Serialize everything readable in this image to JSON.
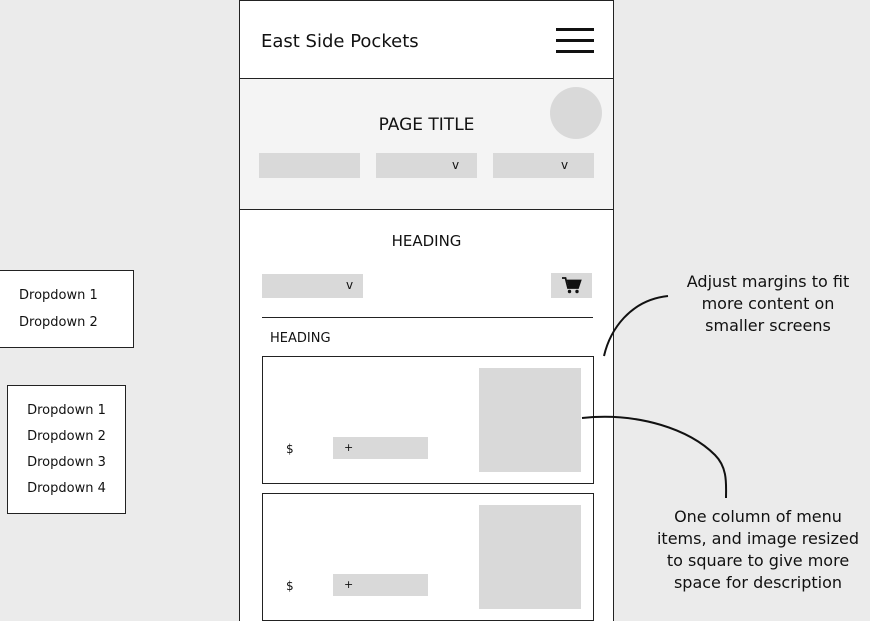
{
  "header": {
    "brand": "East Side Pockets",
    "menu_icon": "hamburger-menu-icon"
  },
  "hero": {
    "title": "PAGE TITLE",
    "filters": [
      {
        "caret": ""
      },
      {
        "caret": "v"
      },
      {
        "caret": "v"
      }
    ]
  },
  "section": {
    "heading": "HEADING",
    "sort_caret": "v",
    "cart_icon": "shopping-cart-icon",
    "subheading": "HEADING"
  },
  "menu_items": [
    {
      "price": "$",
      "add_label": "+"
    },
    {
      "price": "$",
      "add_label": "+"
    }
  ],
  "dropdown_small": {
    "items": [
      "Dropdown 1",
      "Dropdown 2"
    ]
  },
  "dropdown_large": {
    "items": [
      "Dropdown 1",
      "Dropdown 2",
      "Dropdown 3",
      "Dropdown 4"
    ]
  },
  "annotations": {
    "margins_note": [
      "Adjust margins to fit",
      "more content on",
      "smaller screens"
    ],
    "column_note": [
      "One column of menu",
      "items, and image resized",
      "to square to give more",
      "space for description"
    ]
  },
  "colors": {
    "canvas": "#ebebeb",
    "placeholder": "#d9d9d9",
    "hero_background": "#f4f4f4",
    "border": "#222222"
  }
}
